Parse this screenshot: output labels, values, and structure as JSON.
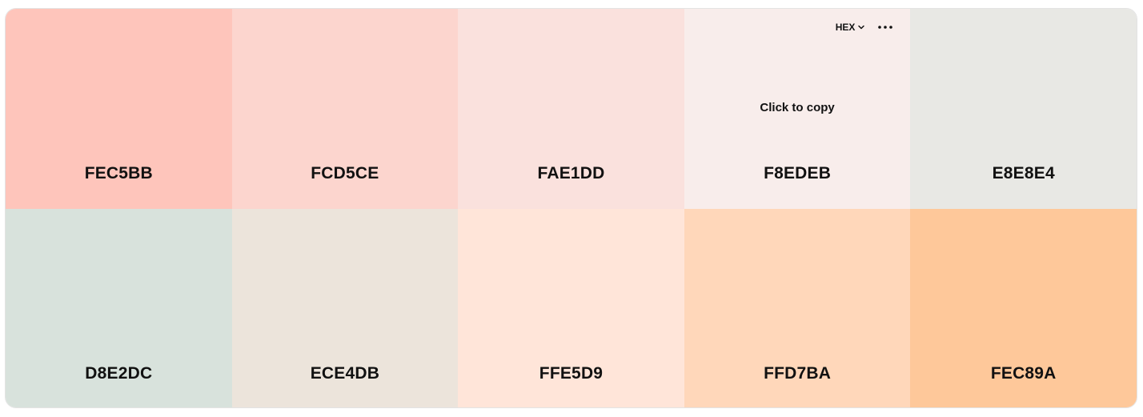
{
  "toolbar": {
    "format_label": "HEX",
    "format_icon": "chevron-down-icon",
    "more_icon": "more-horizontal-icon"
  },
  "hover_hint": "Click to copy",
  "swatches": [
    {
      "hex": "FEC5BB",
      "color": "#FEC5BB"
    },
    {
      "hex": "FCD5CE",
      "color": "#FCD5CE"
    },
    {
      "hex": "FAE1DD",
      "color": "#FAE1DD"
    },
    {
      "hex": "F8EDEB",
      "color": "#F8EDEB"
    },
    {
      "hex": "E8E8E4",
      "color": "#E8E8E4"
    },
    {
      "hex": "D8E2DC",
      "color": "#D8E2DC"
    },
    {
      "hex": "ECE4DB",
      "color": "#ECE4DB"
    },
    {
      "hex": "FFE5D9",
      "color": "#FFE5D9"
    },
    {
      "hex": "FFD7BA",
      "color": "#FFD7BA"
    },
    {
      "hex": "FEC89A",
      "color": "#FEC89A"
    }
  ]
}
